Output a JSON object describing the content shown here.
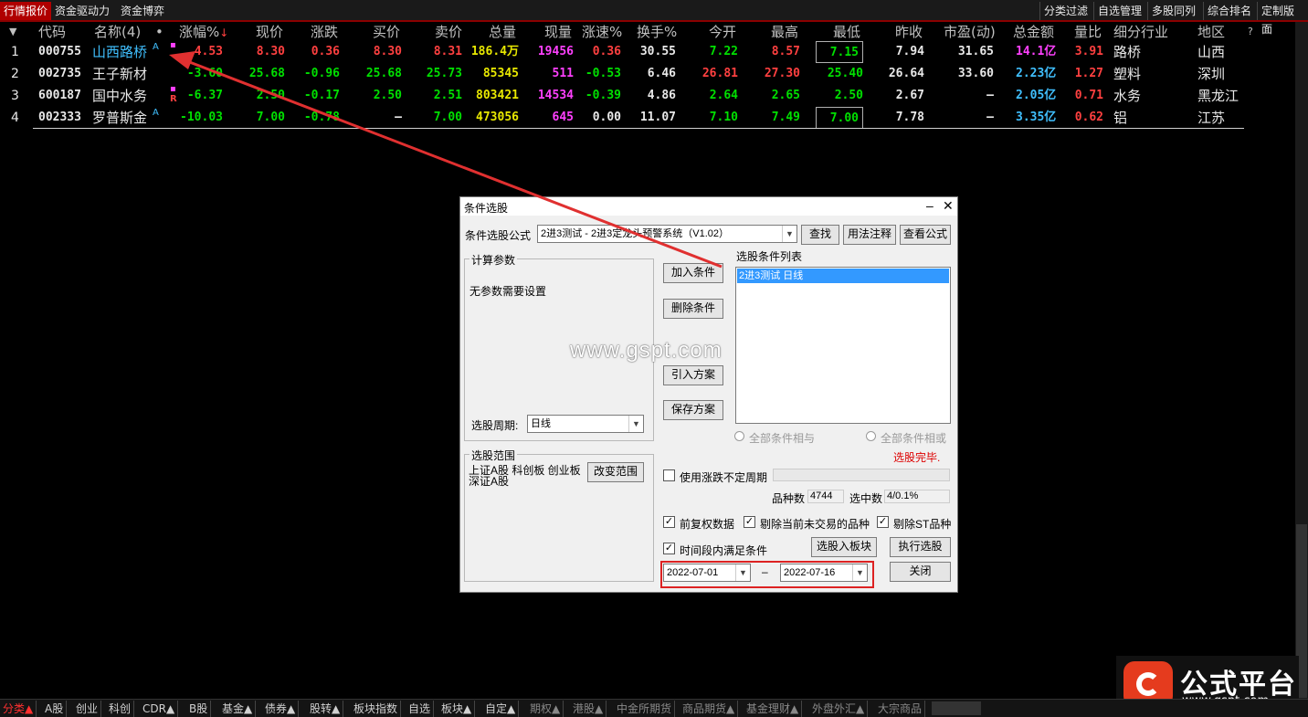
{
  "top_tabs": [
    "行情报价",
    "资金驱动力",
    "资金博弈"
  ],
  "top_right": [
    "分类过滤",
    "自选管理",
    "多股同列",
    "综合排名",
    "定制版面"
  ],
  "columns": [
    "代码",
    "名称(4)",
    "•",
    "涨幅%",
    "现价",
    "涨跌",
    "买价",
    "卖价",
    "总量",
    "现量",
    "涨速%",
    "换手%",
    "今开",
    "最高",
    "最低",
    "昨收",
    "市盈(动)",
    "总金额",
    "量比",
    "细分行业",
    "地区",
    "?"
  ],
  "rows": [
    {
      "idx": "1",
      "code": "000755",
      "name": "山西路桥",
      "sup": "A",
      "pct": "4.53",
      "price": "8.30",
      "chg": "0.36",
      "bid": "8.30",
      "ask": "8.31",
      "vol": "186.4万",
      "cur": "19456",
      "spd": "0.36",
      "turn": "30.55",
      "open": "7.22",
      "high": "8.57",
      "low": "7.15",
      "prev": "7.94",
      "pe": "31.65",
      "amt": "14.1亿",
      "vr": "3.91",
      "ind": "路桥",
      "area": "山西"
    },
    {
      "idx": "2",
      "code": "002735",
      "name": "王子新材",
      "sup": "",
      "pct": "-3.60",
      "price": "25.68",
      "chg": "-0.96",
      "bid": "25.68",
      "ask": "25.73",
      "vol": "85345",
      "cur": "511",
      "spd": "-0.53",
      "turn": "6.46",
      "open": "26.81",
      "high": "27.30",
      "low": "25.40",
      "prev": "26.64",
      "pe": "33.60",
      "amt": "2.23亿",
      "vr": "1.27",
      "ind": "塑料",
      "area": "深圳"
    },
    {
      "idx": "3",
      "code": "600187",
      "name": "国中水务",
      "sup": "R",
      "pct": "-6.37",
      "price": "2.50",
      "chg": "-0.17",
      "bid": "2.50",
      "ask": "2.51",
      "vol": "803421",
      "cur": "14534",
      "spd": "-0.39",
      "turn": "4.86",
      "open": "2.64",
      "high": "2.65",
      "low": "2.50",
      "prev": "2.67",
      "pe": "–",
      "amt": "2.05亿",
      "vr": "0.71",
      "ind": "水务",
      "area": "黑龙江"
    },
    {
      "idx": "4",
      "code": "002333",
      "name": "罗普斯金",
      "sup": "A",
      "pct": "-10.03",
      "price": "7.00",
      "chg": "-0.78",
      "bid": "–",
      "ask": "7.00",
      "vol": "473056",
      "cur": "645",
      "spd": "0.00",
      "turn": "11.07",
      "open": "7.10",
      "high": "7.49",
      "low": "7.00",
      "prev": "7.78",
      "pe": "–",
      "amt": "3.35亿",
      "vr": "0.62",
      "ind": "铝",
      "area": "江苏"
    }
  ],
  "dialog": {
    "title": "条件选股",
    "formula_label": "条件选股公式",
    "formula_value": "2进3测试    -  2进3定龙头预警系统（V1.02）",
    "btn_find": "查找",
    "btn_usage": "用法注释",
    "btn_view": "查看公式",
    "calc_params": "计算参数",
    "no_params": "无参数需要设置",
    "period_label": "选股周期:",
    "period_value": "日线",
    "scope_label": "选股范围",
    "scope_value": "上证A股 科创板 创业板 深证A股",
    "btn_change_scope": "改变范围",
    "btn_add": "加入条件",
    "btn_delete": "删除条件",
    "btn_import": "引入方案",
    "btn_save": "保存方案",
    "cond_list_label": "选股条件列表",
    "cond_item": "2进3测试   日线",
    "radio_and": "全部条件相与",
    "radio_or": "全部条件相或",
    "status": "选股完毕.",
    "use_irregular": "使用涨跌不定周期",
    "count_label": "品种数",
    "count_value": "4744",
    "selected_label": "选中数",
    "selected_value": "4/0.1%",
    "chk_adjust": "前复权数据",
    "chk_exclude_untraded": "剔除当前未交易的品种",
    "chk_exclude_st": "剔除ST品种",
    "chk_period": "时间段内满足条件",
    "btn_to_block": "选股入板块",
    "btn_execute": "执行选股",
    "date_from": "2022-07-01",
    "date_sep": "–",
    "date_to": "2022-07-16",
    "btn_close": "关闭",
    "watermark": "www.gspt.com"
  },
  "bottom_tabs": [
    "分类▲",
    "A股",
    "创业",
    "科创",
    "CDR▲",
    "B股",
    "基金▲",
    "债券▲",
    "股转▲",
    "板块指数",
    "自选",
    "板块▲",
    "自定▲",
    "期权▲",
    "港股▲",
    "中金所期货",
    "商品期货▲",
    "基金理财▲",
    "外盘外汇▲",
    "大宗商品"
  ],
  "logo": {
    "title": "公式平台",
    "url": "www.gspt.com"
  },
  "colors": {
    "accent_red": "#b00000",
    "up": "#ff4040",
    "down": "#00e000",
    "arrow": "#e03030"
  }
}
